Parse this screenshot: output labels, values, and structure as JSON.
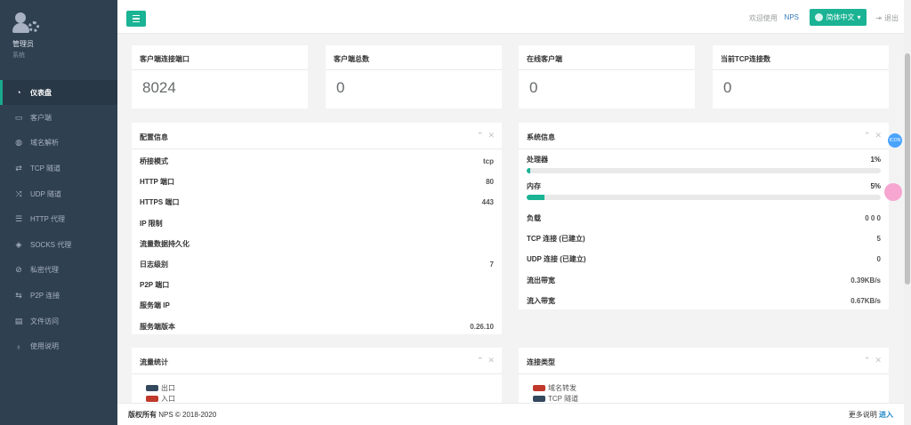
{
  "profile": {
    "name": "管理员",
    "role": "系统"
  },
  "nav": [
    {
      "label": "仪表盘",
      "icon": "dashboard-icon",
      "glyph": "◔",
      "active": true
    },
    {
      "label": "客户端",
      "icon": "desktop-icon",
      "glyph": "▭"
    },
    {
      "label": "域名解析",
      "icon": "globe-icon",
      "glyph": "◍"
    },
    {
      "label": "TCP 隧道",
      "icon": "retweet-icon",
      "glyph": "⇄"
    },
    {
      "label": "UDP 隧道",
      "icon": "random-icon",
      "glyph": "⤨"
    },
    {
      "label": "HTTP 代理",
      "icon": "server-icon",
      "glyph": "☰"
    },
    {
      "label": "SOCKS 代理",
      "icon": "layers-icon",
      "glyph": "◈"
    },
    {
      "label": "私密代理",
      "icon": "eye-slash-icon",
      "glyph": "⊘"
    },
    {
      "label": "P2P 连接",
      "icon": "exchange-icon",
      "glyph": "⇆"
    },
    {
      "label": "文件访问",
      "icon": "archive-icon",
      "glyph": "▤"
    },
    {
      "label": "使用说明",
      "icon": "lightbulb-icon",
      "glyph": "♁"
    }
  ],
  "topbar": {
    "welcome": "欢迎使用",
    "brand": "NPS",
    "lang": "简体中文",
    "logout": "退出"
  },
  "stats": [
    {
      "title": "客户端连接端口",
      "value": "8024"
    },
    {
      "title": "客户端总数",
      "value": "0"
    },
    {
      "title": "在线客户端",
      "value": "0"
    },
    {
      "title": "当前TCP连接数",
      "value": "0"
    }
  ],
  "config": {
    "title": "配置信息",
    "rows": [
      {
        "k": "桥接模式",
        "v": "tcp"
      },
      {
        "k": "HTTP 端口",
        "v": "80"
      },
      {
        "k": "HTTPS 端口",
        "v": "443"
      },
      {
        "k": "IP 限制",
        "v": ""
      },
      {
        "k": "流量数据持久化",
        "v": ""
      },
      {
        "k": "日志级别",
        "v": "7"
      },
      {
        "k": "P2P 端口",
        "v": ""
      },
      {
        "k": "服务端 IP",
        "v": ""
      },
      {
        "k": "服务端版本",
        "v": "0.26.10"
      }
    ]
  },
  "system": {
    "title": "系统信息",
    "cpu": {
      "label": "处理器",
      "value": "1%",
      "percent": 1
    },
    "mem": {
      "label": "内存",
      "value": "5%",
      "percent": 5
    },
    "rows": [
      {
        "k": "负载",
        "v": "0   0   0"
      },
      {
        "k": "TCP 连接 (已建立)",
        "v": "5"
      },
      {
        "k": "UDP 连接 (已建立)",
        "v": "0"
      },
      {
        "k": "流出带宽",
        "v": "0.39KB/s"
      },
      {
        "k": "流入带宽",
        "v": "0.67KB/s"
      }
    ]
  },
  "traffic": {
    "title": "流量统计",
    "legend": [
      {
        "label": "出口",
        "color": "#34495e"
      },
      {
        "label": "入口",
        "color": "#c0392b"
      }
    ]
  },
  "conntype": {
    "title": "连接类型",
    "legend": [
      {
        "label": "域名转发",
        "color": "#c0392b"
      },
      {
        "label": "TCP 隧道",
        "color": "#34495e"
      }
    ]
  },
  "footer": {
    "copyright": "版权所有",
    "text": "NPS © 2018-2020",
    "more": "更多说明",
    "link": "进入"
  },
  "colors": {
    "accent": "#1ab394",
    "sidebar": "#2f4050",
    "link": "#1c84c6"
  }
}
